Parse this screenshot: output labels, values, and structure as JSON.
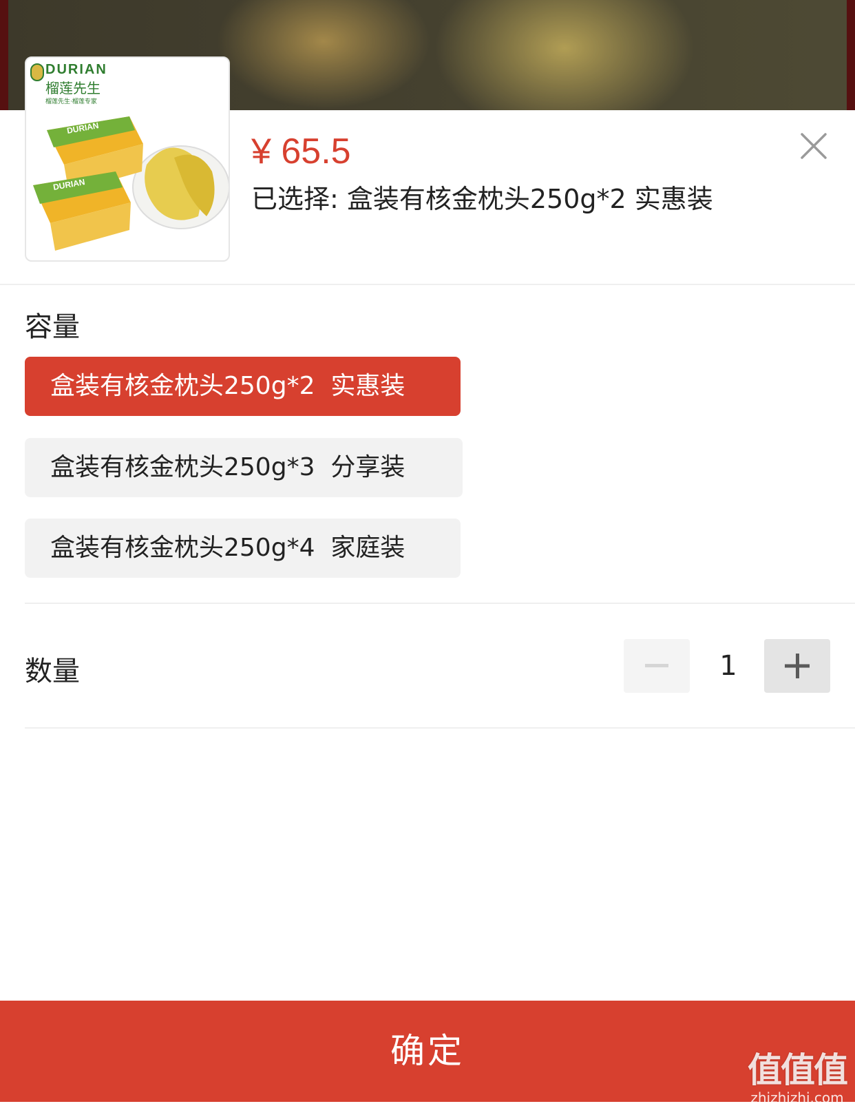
{
  "product": {
    "brand_en": "DURIAN",
    "brand_cn": "榴莲先生",
    "brand_sub": "榴莲先生·榴莲专家",
    "price": "¥ 65.5",
    "selected_text": "已选择: 盒装有核金枕头250g*2  实惠装"
  },
  "capacity": {
    "label": "容量",
    "options": [
      {
        "label": "盒装有核金枕头250g*2  实惠装",
        "selected": true
      },
      {
        "label": "盒装有核金枕头250g*3  分享装",
        "selected": false
      },
      {
        "label": "盒装有核金枕头250g*4  家庭装",
        "selected": false
      }
    ]
  },
  "quantity": {
    "label": "数量",
    "value": "1",
    "minus_label": "−",
    "plus_label": "+"
  },
  "footer": {
    "confirm_label": "确定"
  },
  "watermark": {
    "cn": "值值值",
    "en": "zhizhizhi.com"
  },
  "colors": {
    "accent": "#d7402f",
    "option_idle_bg": "#f2f2f2",
    "divider": "#efefef"
  }
}
